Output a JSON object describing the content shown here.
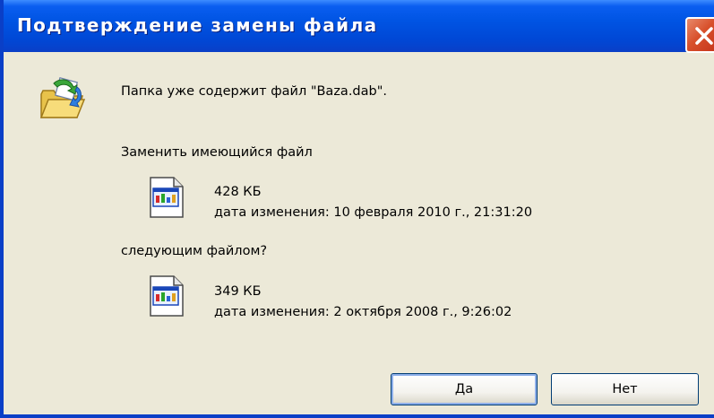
{
  "window": {
    "title": "Подтверждение замены файла"
  },
  "message": {
    "folder_contains": "Папка уже содержит файл \"Baza.dab\".",
    "replace_prompt": "Заменить имеющийся файл",
    "with_prompt": "следующим файлом?"
  },
  "existing_file": {
    "size": "428 КБ",
    "modified": "дата изменения: 10 февраля 2010 г., 21:31:20"
  },
  "new_file": {
    "size": "349 КБ",
    "modified": "дата изменения: 2 октября 2008 г., 9:26:02"
  },
  "buttons": {
    "yes": "Да",
    "no": "Нет"
  },
  "icons": {
    "folder": "folder-replace-icon",
    "file": "file-icon",
    "close": "close-icon"
  },
  "colors": {
    "titlebar": "#0054e3",
    "close": "#d8502b",
    "dialog_bg": "#ece9d8"
  }
}
